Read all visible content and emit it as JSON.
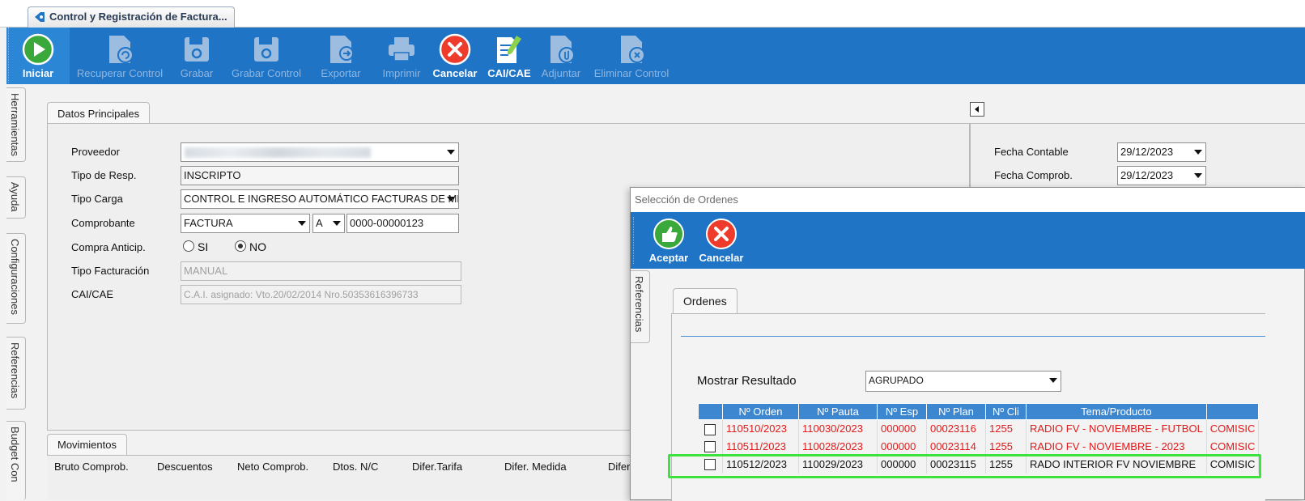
{
  "tab": {
    "title": "Control y Registración de Factura..."
  },
  "toolbar": [
    {
      "name": "iniciar",
      "label": "Iniciar",
      "icon": "play-icon",
      "active": true
    },
    {
      "name": "recuperar-control",
      "label": "Recuperar Control",
      "icon": "document-recover-icon",
      "active": false
    },
    {
      "name": "grabar",
      "label": "Grabar",
      "icon": "save-disk-icon",
      "active": false
    },
    {
      "name": "grabar-control",
      "label": "Grabar Control",
      "icon": "save-disk-icon",
      "active": false
    },
    {
      "name": "exportar",
      "label": "Exportar",
      "icon": "document-export-icon",
      "active": false
    },
    {
      "name": "imprimir",
      "label": "Imprimir",
      "icon": "printer-icon",
      "active": false
    },
    {
      "name": "cancelar",
      "label": "Cancelar",
      "icon": "cancel-x-icon",
      "active": true
    },
    {
      "name": "cai-cae",
      "label": "CAI/CAE",
      "icon": "document-edit-icon",
      "active": true
    },
    {
      "name": "adjuntar",
      "label": "Adjuntar",
      "icon": "document-attach-icon",
      "active": false
    },
    {
      "name": "eliminar-control",
      "label": "Eliminar Control",
      "icon": "document-delete-icon",
      "active": false
    }
  ],
  "side_tabs": [
    "Herramientas",
    "Ayuda",
    "Configuraciones",
    "Referencias",
    "Budget Con"
  ],
  "main": {
    "tab_label": "Datos Principales",
    "fields": {
      "proveedor": {
        "label": "Proveedor",
        "value": ""
      },
      "tipo_resp": {
        "label": "Tipo de Resp.",
        "value": "INSCRIPTO"
      },
      "tipo_carga": {
        "label": "Tipo Carga",
        "value": "CONTROL E INGRESO AUTOMÁTICO FACTURAS DE MED"
      },
      "comprobante": {
        "label": "Comprobante",
        "tipo": "FACTURA",
        "letra": "A",
        "numero": "0000-00000123"
      },
      "compra_anticip": {
        "label": "Compra Anticip.",
        "si": "SI",
        "no": "NO",
        "selected": "NO"
      },
      "tipo_facturacion": {
        "label": "Tipo Facturación",
        "value": "MANUAL"
      },
      "cai_cae": {
        "label": "CAI/CAE",
        "value": "C.A.I. asignado: Vto.20/02/2014 Nro.50353616396733"
      }
    }
  },
  "right": {
    "fecha_contable": {
      "label": "Fecha Contable",
      "value": "29/12/2023"
    },
    "fecha_comprob": {
      "label": "Fecha Comprob.",
      "value": "29/12/2023"
    }
  },
  "movimientos": {
    "tab_label": "Movimientos",
    "columns": [
      "Bruto Comprob.",
      "Descuentos",
      "Neto Comprob.",
      "Dtos. N/C",
      "Difer.Tarifa",
      "Difer. Medida",
      "Difer"
    ]
  },
  "dialog": {
    "title": "Selección de Ordenes",
    "buttons": [
      {
        "name": "aceptar",
        "label": "Aceptar",
        "icon": "thumbs-up-icon"
      },
      {
        "name": "cancelar",
        "label": "Cancelar",
        "icon": "cancel-x-icon"
      }
    ],
    "side_tab": "Referencias",
    "tab_label": "Ordenes",
    "mostrar_label": "Mostrar Resultado",
    "mostrar_value": "AGRUPADO",
    "headers": [
      "Nº Orden",
      "Nº Pauta",
      "Nº Esp",
      "Nº Plan",
      "Nº Cli",
      "Tema/Producto",
      ""
    ],
    "rows": [
      {
        "orden": "110510/2023",
        "pauta": "110030/2023",
        "esp": "000000",
        "plan": "00023116",
        "cli": "1255",
        "tema": "RADIO FV - NOVIEMBRE - FUTBOL",
        "extra": "COMISIC",
        "style": "red"
      },
      {
        "orden": "110511/2023",
        "pauta": "110028/2023",
        "esp": "000000",
        "plan": "00023114",
        "cli": "1255",
        "tema": "RADIO FV - NOVIEMBRE  - 2023",
        "extra": "COMISIC",
        "style": "red"
      },
      {
        "orden": "110512/2023",
        "pauta": "110029/2023",
        "esp": "000000",
        "plan": "00023115",
        "cli": "1255",
        "tema": "RADO INTERIOR FV NOVIEMBRE",
        "extra": "COMISIC",
        "style": "sel"
      }
    ]
  },
  "colors": {
    "toolbar": "#1f74c6",
    "grid_header": "#3d86d0",
    "red_row": "#e01b1b",
    "highlight": "#3de23d"
  }
}
